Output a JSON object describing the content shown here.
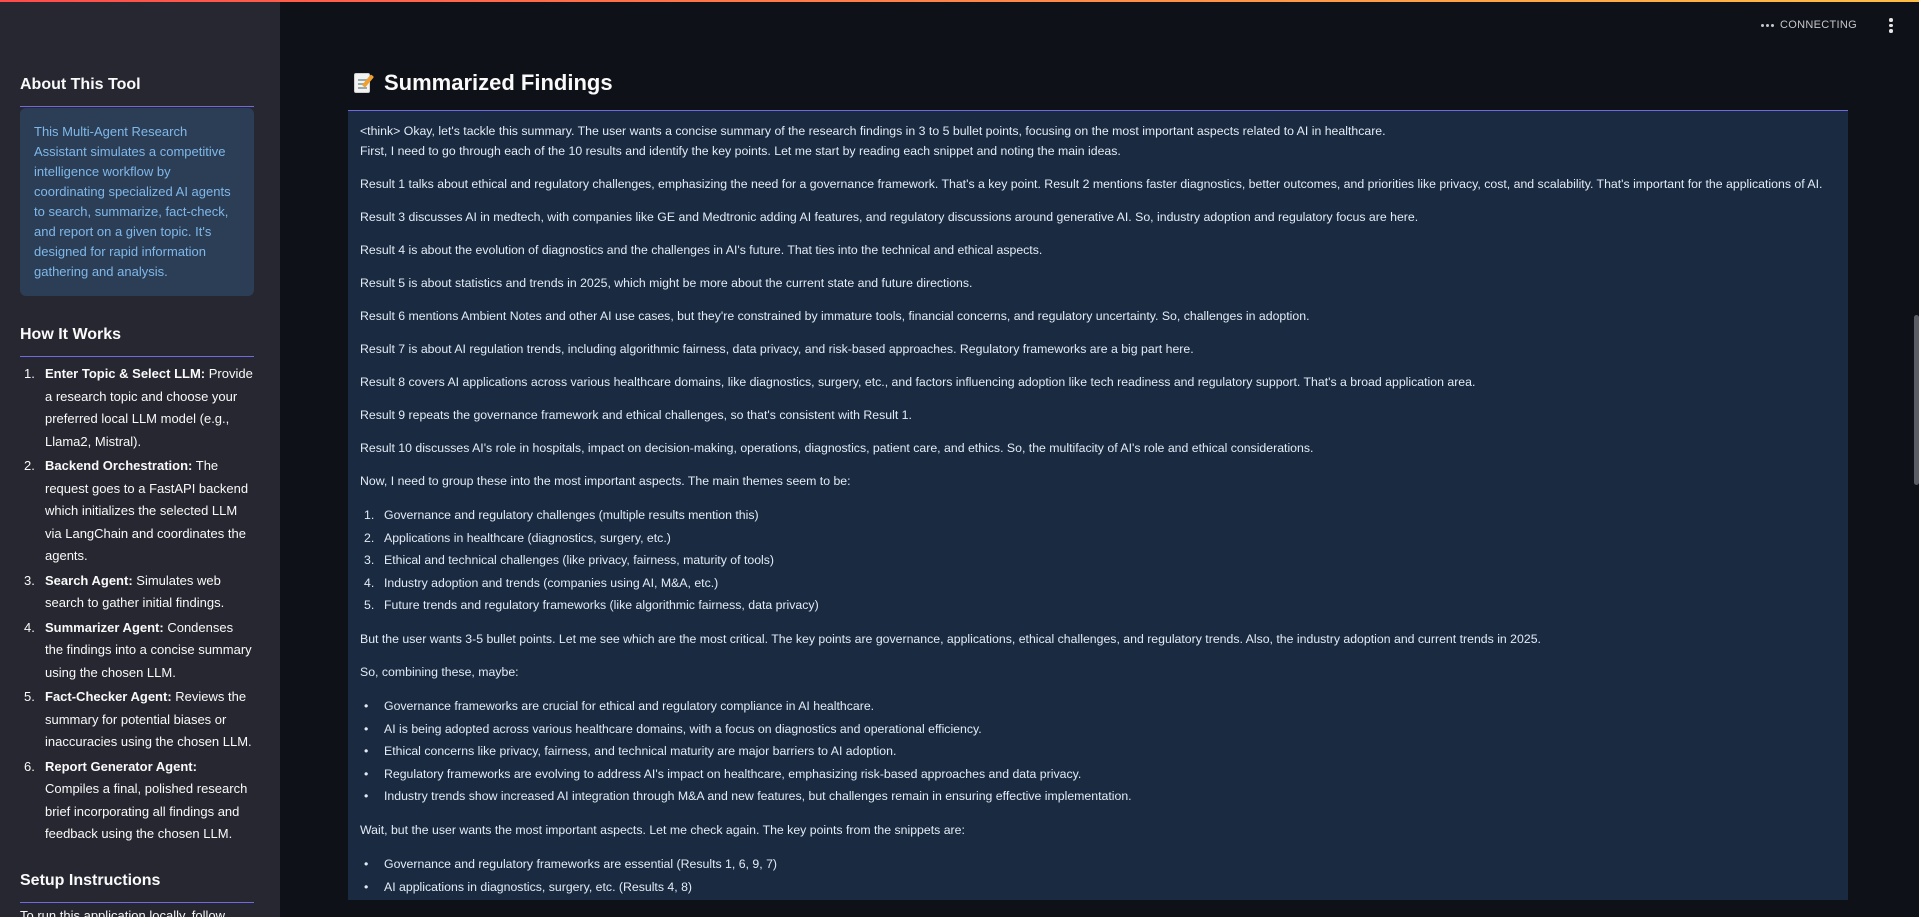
{
  "sidebar": {
    "about": {
      "heading": "About This Tool",
      "body": "This Multi-Agent Research Assistant simulates a competitive intelligence workflow by coordinating specialized AI agents to search, summarize, fact-check, and report on a given topic. It's designed for rapid information gathering and analysis."
    },
    "how": {
      "heading": "How It Works",
      "steps": [
        {
          "num": "1.",
          "bold": "Enter Topic & Select LLM:",
          "text": " Provide a research topic and choose your preferred local LLM model (e.g., Llama2, Mistral)."
        },
        {
          "num": "2.",
          "bold": "Backend Orchestration:",
          "text": " The request goes to a FastAPI backend which initializes the selected LLM via LangChain and coordinates the agents."
        },
        {
          "num": "3.",
          "bold": "Search Agent:",
          "text": " Simulates web search to gather initial findings."
        },
        {
          "num": "4.",
          "bold": "Summarizer Agent:",
          "text": " Condenses the findings into a concise summary using the chosen LLM."
        },
        {
          "num": "5.",
          "bold": "Fact-Checker Agent:",
          "text": " Reviews the summary for potential biases or inaccuracies using the chosen LLM."
        },
        {
          "num": "6.",
          "bold": "Report Generator Agent:",
          "text": " Compiles a final, polished research brief incorporating all findings and feedback using the chosen LLM."
        }
      ]
    },
    "setup": {
      "heading": "Setup Instructions",
      "body": "To run this application locally, follow"
    }
  },
  "header": {
    "status": "CONNECTING",
    "status_icon": "ellipsis-icon",
    "menu_icon": "kebab-menu-icon"
  },
  "main": {
    "title": "Summarized Findings",
    "title_icon": "memo-icon",
    "findings": {
      "intro1": "<think> Okay, let's tackle this summary. The user wants a concise summary of the research findings in 3 to 5 bullet points, focusing on the most important aspects related to AI in healthcare.",
      "intro2": "First, I need to go through each of the 10 results and identify the key points. Let me start by reading each snippet and noting the main ideas.",
      "results": [
        "Result 1 talks about ethical and regulatory challenges, emphasizing the need for a governance framework. That's a key point. Result 2 mentions faster diagnostics, better outcomes, and priorities like privacy, cost, and scalability. That's important for the applications of AI.",
        "Result 3 discusses AI in medtech, with companies like GE and Medtronic adding AI features, and regulatory discussions around generative AI. So, industry adoption and regulatory focus are here.",
        "Result 4 is about the evolution of diagnostics and the challenges in AI's future. That ties into the technical and ethical aspects.",
        "Result 5 is about statistics and trends in 2025, which might be more about the current state and future directions.",
        "Result 6 mentions Ambient Notes and other AI use cases, but they're constrained by immature tools, financial concerns, and regulatory uncertainty. So, challenges in adoption.",
        "Result 7 is about AI regulation trends, including algorithmic fairness, data privacy, and risk-based approaches. Regulatory frameworks are a big part here.",
        "Result 8 covers AI applications across various healthcare domains, like diagnostics, surgery, etc., and factors influencing adoption like tech readiness and regulatory support. That's a broad application area.",
        "Result 9 repeats the governance framework and ethical challenges, so that's consistent with Result 1.",
        "Result 10 discusses AI's role in hospitals, impact on decision-making, operations, diagnostics, patient care, and ethics. So, the multifacity of AI's role and ethical considerations."
      ],
      "group_intro": "Now, I need to group these into the most important aspects. The main themes seem to be:",
      "themes": [
        "Governance and regulatory challenges (multiple results mention this)",
        "Applications in healthcare (diagnostics, surgery, etc.)",
        "Ethical and technical challenges (like privacy, fairness, maturity of tools)",
        "Industry adoption and trends (companies using AI, M&A, etc.)",
        "Future trends and regulatory frameworks (like algorithmic fairness, data privacy)"
      ],
      "critical": "But the user wants 3-5 bullet points. Let me see which are the most critical. The key points are governance, applications, ethical challenges, and regulatory trends. Also, the industry adoption and current trends in 2025.",
      "combining": "So, combining these, maybe:",
      "bullets": [
        "Governance frameworks are crucial for ethical and regulatory compliance in AI healthcare.",
        "AI is being adopted across various healthcare domains, with a focus on diagnostics and operational efficiency.",
        "Ethical concerns like privacy, fairness, and technical maturity are major barriers to AI adoption.",
        "Regulatory frameworks are evolving to address AI's impact on healthcare, emphasizing risk-based approaches and data privacy.",
        "Industry trends show increased AI integration through M&A and new features, but challenges remain in ensuring effective implementation."
      ],
      "wait": "Wait, but the user wants the most important aspects. Let me check again. The key points from the snippets are:",
      "bullets2": [
        "Governance and regulatory frameworks are essential (Results 1, 6, 9, 7)",
        "AI applications in diagnostics, surgery, etc. (Results 4, 8)"
      ],
      "bullet_glyph": "•"
    }
  }
}
